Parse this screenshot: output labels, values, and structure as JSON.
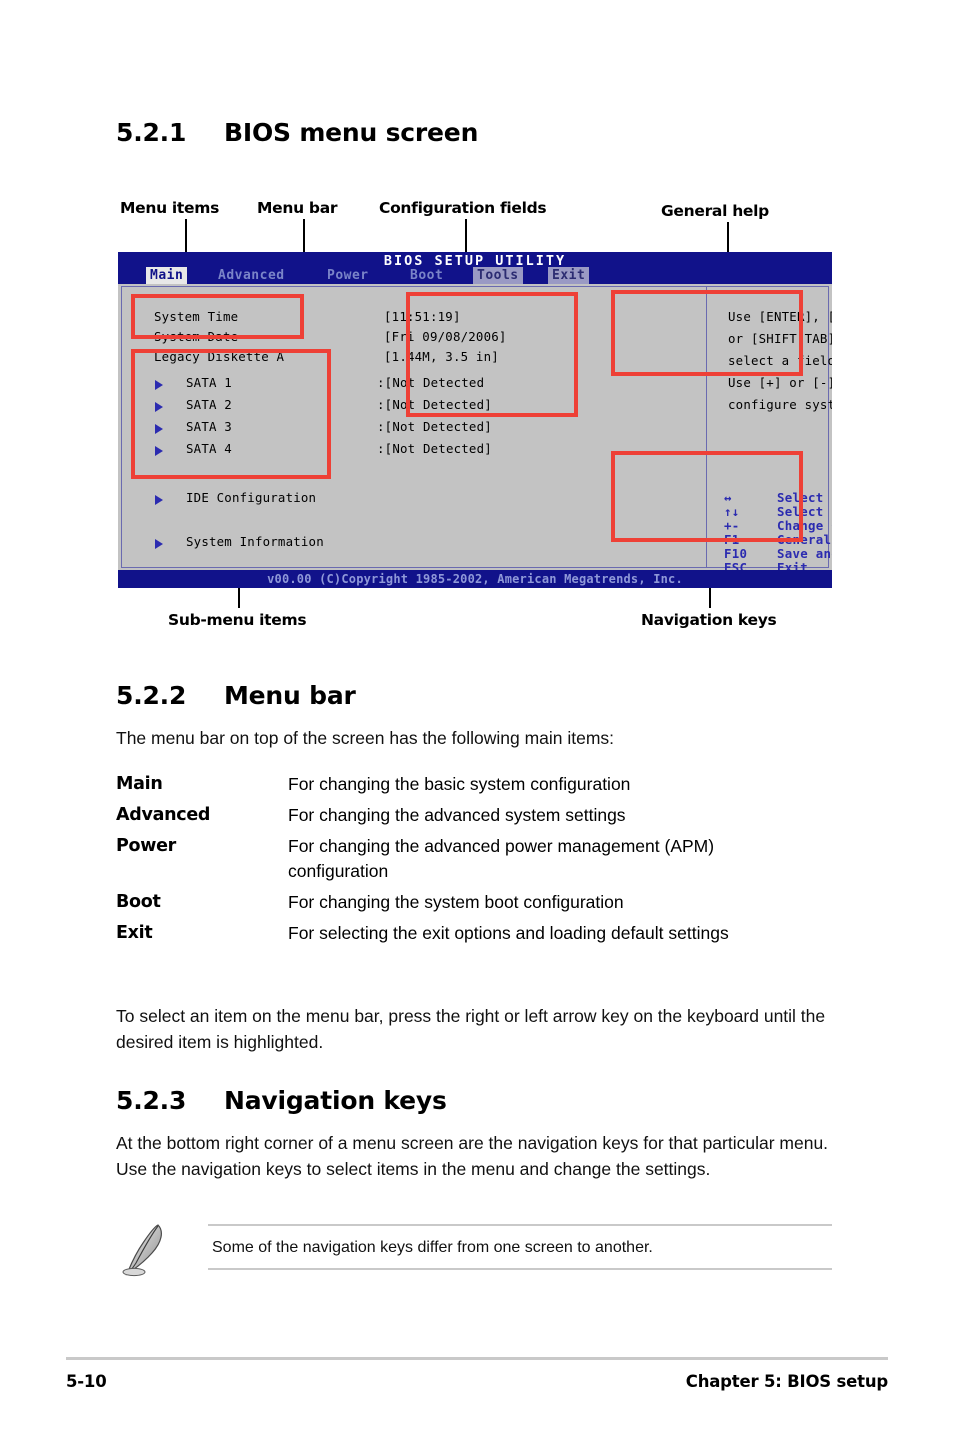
{
  "sections": {
    "s1": {
      "num": "5.2.1",
      "title": "BIOS menu screen"
    },
    "s2": {
      "num": "5.2.2",
      "title": "Menu bar"
    },
    "s3": {
      "num": "5.2.3",
      "title": "Navigation keys"
    }
  },
  "callouts": {
    "menu_items": "Menu items",
    "menu_bar": "Menu bar",
    "configuration_fields": "Configuration fields",
    "general_help": "General help",
    "sub_menu_items": "Sub-menu items",
    "navigation_keys": "Navigation keys"
  },
  "bios": {
    "title": "BIOS SETUP UTILITY",
    "tabs": [
      {
        "label": "Main",
        "state": "selected"
      },
      {
        "label": "Advanced",
        "state": "normal"
      },
      {
        "label": "Power",
        "state": "normal"
      },
      {
        "label": "Boot",
        "state": "normal"
      },
      {
        "label": "Tools",
        "state": "dim"
      },
      {
        "label": "Exit",
        "state": "dim"
      }
    ],
    "menu_items": [
      {
        "label": "System Time",
        "value": "[11:51:19]",
        "submenu": false
      },
      {
        "label": "System Date",
        "value": "[Fri 09/08/2006]",
        "submenu": false
      },
      {
        "label": "Legacy Diskette A",
        "value": "[1.44M, 3.5 in]",
        "submenu": false
      },
      {
        "label": "SATA 1",
        "value": ":[Not Detected",
        "submenu": true
      },
      {
        "label": "SATA 2",
        "value": ":[Not Detected]",
        "submenu": true
      },
      {
        "label": "SATA 3",
        "value": ":[Not Detected]",
        "submenu": true
      },
      {
        "label": "SATA 4",
        "value": ":[Not Detected]",
        "submenu": true
      },
      {
        "label": "IDE Configuration",
        "value": "",
        "submenu": true
      },
      {
        "label": "System Information",
        "value": "",
        "submenu": true
      }
    ],
    "help_lines": [
      "Use [ENTER], [TAB]",
      "or [SHIFT-TAB] to",
      "select a field.",
      "Use [+] or [-] to",
      "configure system time."
    ],
    "nav_keys": [
      {
        "key": "↔",
        "action": "Select Screen"
      },
      {
        "key": "↑↓",
        "action": "Select Item"
      },
      {
        "key": "+-",
        "action": "Change Option"
      },
      {
        "key": "F1",
        "action": "General Help"
      },
      {
        "key": "F10",
        "action": "Save and Exit"
      },
      {
        "key": "ESC",
        "action": "Exit"
      }
    ],
    "footer": "v00.00 (C)Copyright 1985-2002, American Megatrends, Inc.",
    "colors": {
      "titlebar": "#11128a",
      "panel": "#c3c3c3",
      "accent_blue": "#2b2bb0",
      "annotation_red": "#ee4036"
    }
  },
  "menubar_section": {
    "intro": "The menu bar on top of the screen has the following main items:",
    "entries": [
      {
        "term": "Main",
        "desc": "For changing the basic system configuration"
      },
      {
        "term": "Advanced",
        "desc": "For changing the advanced system settings"
      },
      {
        "term": "Power",
        "desc": "For changing the advanced power management (APM) configuration"
      },
      {
        "term": "Boot",
        "desc": "For changing the system boot configuration"
      },
      {
        "term": "Exit",
        "desc": "For selecting the exit options and loading default settings"
      }
    ],
    "outro": "To select an item on the menu bar, press the right or left arrow key on the keyboard until the desired item is highlighted."
  },
  "navkeys_section": {
    "paragraph": "At the bottom right corner of a menu screen are the navigation keys for that particular menu. Use the navigation keys to select items in the menu and change the settings.",
    "note": "Some of the navigation keys differ from one screen to another."
  },
  "page_footer": {
    "page_number": "5-10",
    "chapter": "Chapter 5: BIOS setup"
  }
}
